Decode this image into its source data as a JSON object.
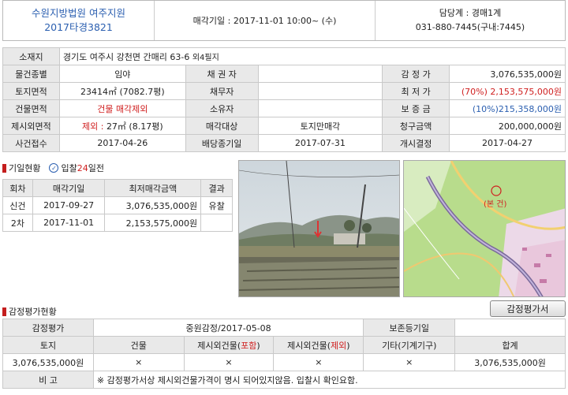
{
  "header": {
    "court": "수원지방법원 여주지원",
    "case_no": "2017타경3821",
    "sale_date_text": "매각기일 : 2017-11-01  10:00~ (수)",
    "dept": "담당계 : 경매1계",
    "phone": "031-880-7445(구내:7445)"
  },
  "info": {
    "address_label": "소재지",
    "address": "경기도 여주시 강천면 간매리 63-6",
    "address_extra": "외4필지",
    "type_label": "물건종별",
    "type": "임야",
    "creditor_label": "채 권 자",
    "creditor": "",
    "appraisal_label": "감 정 가",
    "appraisal": "3,076,535,000원",
    "land_label": "토지면적",
    "land": "23414㎡ (7082.7평)",
    "debtor_label": "채무자",
    "debtor": "",
    "min_label": "최 저 가",
    "min": "(70%) 2,153,575,000원",
    "bldg_label": "건물면적",
    "bldg": "건물 매각제외",
    "owner_label": "소유자",
    "owner": "",
    "deposit_label": "보 증 금",
    "deposit": "(10%)215,358,000원",
    "excl_label": "제시외면적",
    "excl_prefix": "제외 : ",
    "excl": "27㎡ (8.17평)",
    "target_label": "매각대상",
    "target": "토지만매각",
    "claim_label": "청구금액",
    "claim": "200,000,000원",
    "filed_label": "사건접수",
    "filed": "2017-04-26",
    "dividend_label": "배당종기일",
    "dividend": "2017-07-31",
    "start_label": "개시결정",
    "start": "2017-04-27"
  },
  "history": {
    "title": "기일현황",
    "dday_prefix": "입찰",
    "dday_num": "24",
    "dday_suffix": "일전",
    "cols": [
      "회차",
      "매각기일",
      "최저매각금액",
      "결과"
    ],
    "rows": [
      [
        "신건",
        "2017-09-27",
        "3,076,535,000원",
        "유찰"
      ],
      [
        "2차",
        "2017-11-01",
        "2,153,575,000원",
        ""
      ]
    ]
  },
  "map": {
    "marker": "(본 건)"
  },
  "eval": {
    "title": "감정평가현황",
    "button": "감정평가서",
    "label_eval": "감정평가",
    "eval_value": "중원감정/2017-05-08",
    "label_base": "보존등기일",
    "base_value": "",
    "cols": [
      "토지",
      "건물",
      "제시외건물(",
      "포함",
      ")",
      "제시외건물(",
      "제외",
      ")",
      "기타(기계기구)",
      "합계"
    ],
    "col_land": "토지",
    "col_bldg": "건물",
    "col_inc_a": "제시외건물(",
    "col_inc_b": "포함",
    "col_inc_c": ")",
    "col_exc_a": "제시외건물(",
    "col_exc_b": "제외",
    "col_exc_c": ")",
    "col_etc": "기타(기계기구)",
    "col_sum": "합계",
    "val_land": "3,076,535,000원",
    "val_bldg": "×",
    "val_inc": "×",
    "val_exc": "×",
    "val_etc": "×",
    "val_sum": "3,076,535,000원",
    "note_label": "비 고",
    "note": "※ 감정평가서상 제시외건물가격이 명시 되어있지않음. 입찰시 확인요함."
  }
}
